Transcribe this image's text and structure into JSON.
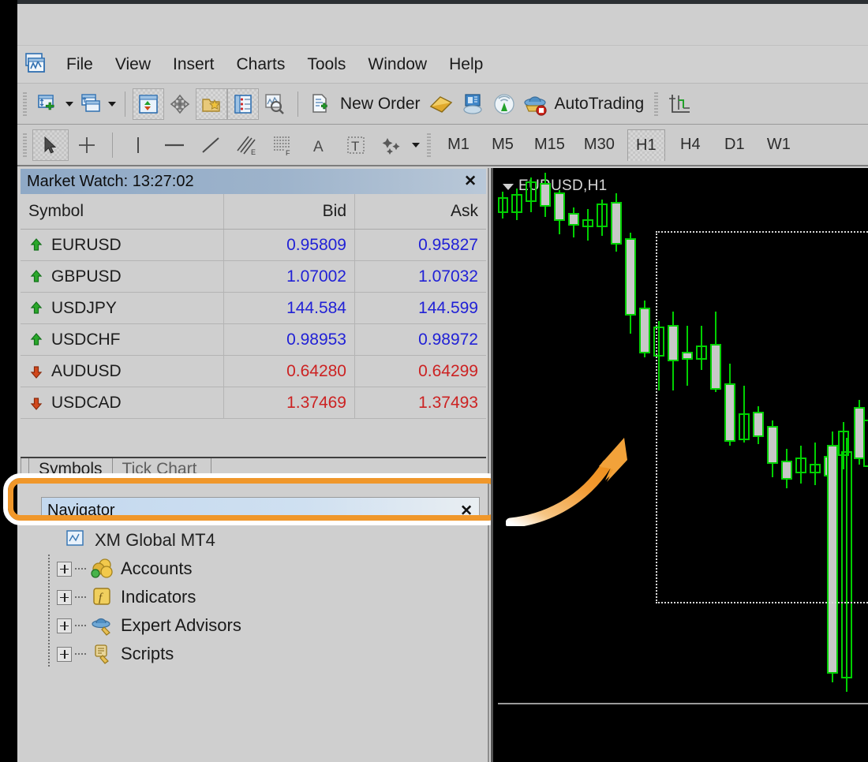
{
  "app": {
    "icon": "metatrader-app-icon"
  },
  "menu": {
    "items": [
      {
        "label": "File"
      },
      {
        "label": "View"
      },
      {
        "label": "Insert"
      },
      {
        "label": "Charts"
      },
      {
        "label": "Tools"
      },
      {
        "label": "Window"
      },
      {
        "label": "Help"
      }
    ]
  },
  "toolbar_main": {
    "buttons": [
      {
        "name": "new-chart-button",
        "icon": "new-chart-icon"
      },
      {
        "name": "new-chart-dropdown",
        "icon": "chevron-down-icon"
      },
      {
        "name": "profiles-button",
        "icon": "profiles-icon"
      },
      {
        "name": "profiles-dropdown",
        "icon": "chevron-down-icon"
      },
      {
        "name": "market-watch-button",
        "icon": "market-watch-icon"
      },
      {
        "name": "data-window-button",
        "icon": "data-window-icon"
      },
      {
        "name": "navigator-button",
        "icon": "navigator-folder-star-icon"
      },
      {
        "name": "terminal-button",
        "icon": "terminal-list-icon"
      },
      {
        "name": "strategy-tester-button",
        "icon": "strategy-tester-magnifier-icon"
      }
    ],
    "new_order_label": "New Order",
    "new_order_icon": "new-order-icon",
    "metaeditor_icon": "metaeditor-icon",
    "mql5_community_icon": "mql5-community-icon",
    "signals_icon": "signals-broadcast-icon",
    "autotrading_label": "AutoTrading",
    "autotrading_icon": "autotrading-hat-icon",
    "crosshair_icon": "crosshair-axis-icon"
  },
  "toolbar_draw": {
    "tools": [
      {
        "name": "cursor-tool",
        "icon": "cursor-arrow-icon",
        "selected": true
      },
      {
        "name": "crosshair-tool",
        "icon": "crosshair-icon",
        "selected": false
      },
      {
        "name": "vertical-line-tool",
        "icon": "vertical-line-icon",
        "selected": false
      },
      {
        "name": "horizontal-line-tool",
        "icon": "horizontal-line-icon",
        "selected": false
      },
      {
        "name": "trendline-tool",
        "icon": "trendline-icon",
        "selected": false
      },
      {
        "name": "equidistant-channel-tool",
        "icon": "equidistant-channel-icon",
        "selected": false
      },
      {
        "name": "fibonacci-retracement-tool",
        "icon": "fibonacci-icon",
        "selected": false
      },
      {
        "name": "text-tool",
        "icon": "text-a-icon",
        "selected": false
      },
      {
        "name": "text-label-tool",
        "icon": "text-label-t-icon",
        "selected": false
      },
      {
        "name": "shapes-tool",
        "icon": "shapes-icon",
        "selected": false
      },
      {
        "name": "shapes-dropdown",
        "icon": "chevron-down-icon",
        "selected": false
      }
    ],
    "timeframes": [
      {
        "label": "M1",
        "active": false
      },
      {
        "label": "M5",
        "active": false
      },
      {
        "label": "M15",
        "active": false
      },
      {
        "label": "M30",
        "active": false
      },
      {
        "label": "H1",
        "active": true
      },
      {
        "label": "H4",
        "active": false
      },
      {
        "label": "D1",
        "active": false
      },
      {
        "label": "W1",
        "active": false
      }
    ]
  },
  "market_watch": {
    "title": "Market Watch: 13:27:02",
    "close_icon": "close-x-icon",
    "columns": [
      "Symbol",
      "Bid",
      "Ask"
    ],
    "rows": [
      {
        "symbol": "EURUSD",
        "bid": "0.95809",
        "ask": "0.95827",
        "direction": "up"
      },
      {
        "symbol": "GBPUSD",
        "bid": "1.07002",
        "ask": "1.07032",
        "direction": "up"
      },
      {
        "symbol": "USDJPY",
        "bid": "144.584",
        "ask": "144.599",
        "direction": "up"
      },
      {
        "symbol": "USDCHF",
        "bid": "0.98953",
        "ask": "0.98972",
        "direction": "up"
      },
      {
        "symbol": "AUDUSD",
        "bid": "0.64280",
        "ask": "0.64299",
        "direction": "down"
      },
      {
        "symbol": "USDCAD",
        "bid": "1.37469",
        "ask": "1.37493",
        "direction": "down"
      }
    ],
    "tabs": [
      {
        "label": "Symbols",
        "active": true
      },
      {
        "label": "Tick Chart",
        "active": false
      }
    ]
  },
  "navigator": {
    "title": "Navigator",
    "close_icon": "close-x-icon",
    "highlight_color": "#f0972a",
    "root": {
      "label": "XM Global MT4",
      "icon": "mt4-terminal-icon"
    },
    "nodes": [
      {
        "label": "Accounts",
        "icon": "accounts-coins-icon",
        "expander": "plus"
      },
      {
        "label": "Indicators",
        "icon": "indicators-function-icon",
        "expander": "plus"
      },
      {
        "label": "Expert Advisors",
        "icon": "expert-advisor-hat-icon",
        "expander": "plus"
      },
      {
        "label": "Scripts",
        "icon": "scripts-scroll-icon",
        "expander": "plus"
      }
    ]
  },
  "chart": {
    "label": "EURUSD,H1",
    "dropdown_icon": "chevron-down-icon",
    "annotation_icon": "orange-curved-arrow-icon",
    "selection_rect": "chart-selection-rectangle",
    "bullish_color": "#00d000",
    "bearish_body_color": "#c8c8c8",
    "background_color": "#000000"
  },
  "chart_data": {
    "type": "candlestick",
    "title": "EURUSD,H1",
    "symbol": "EURUSD",
    "timeframe": "H1",
    "xlabel": "",
    "ylabel": "",
    "grid": false,
    "legend": "none",
    "series": [
      {
        "name": "EURUSD H1 candles",
        "fields": [
          "open",
          "high",
          "low",
          "close"
        ],
        "candles": [
          {
            "open": 0.969,
            "high": 0.9697,
            "low": 0.9684,
            "close": 0.9693
          },
          {
            "open": 0.9693,
            "high": 0.97,
            "low": 0.9686,
            "close": 0.9688
          },
          {
            "open": 0.9688,
            "high": 0.9706,
            "low": 0.9684,
            "close": 0.97
          },
          {
            "open": 0.97,
            "high": 0.9712,
            "low": 0.9692,
            "close": 0.9694
          },
          {
            "open": 0.9694,
            "high": 0.9697,
            "low": 0.9672,
            "close": 0.9676
          },
          {
            "open": 0.9676,
            "high": 0.9682,
            "low": 0.9665,
            "close": 0.9672
          },
          {
            "open": 0.9672,
            "high": 0.968,
            "low": 0.966,
            "close": 0.967
          },
          {
            "open": 0.967,
            "high": 0.9686,
            "low": 0.9664,
            "close": 0.968
          },
          {
            "open": 0.968,
            "high": 0.9692,
            "low": 0.9636,
            "close": 0.964
          },
          {
            "open": 0.964,
            "high": 0.9644,
            "low": 0.9592,
            "close": 0.9596
          },
          {
            "open": 0.9596,
            "high": 0.9608,
            "low": 0.9576,
            "close": 0.9582
          },
          {
            "open": 0.9582,
            "high": 0.9588,
            "low": 0.956,
            "close": 0.9586
          },
          {
            "open": 0.9586,
            "high": 0.96,
            "low": 0.9548,
            "close": 0.9568
          },
          {
            "open": 0.9568,
            "high": 0.958,
            "low": 0.954,
            "close": 0.9566
          },
          {
            "open": 0.9566,
            "high": 0.9586,
            "low": 0.9552,
            "close": 0.9572
          },
          {
            "open": 0.9572,
            "high": 0.9604,
            "low": 0.9532,
            "close": 0.954
          },
          {
            "open": 0.954,
            "high": 0.9548,
            "low": 0.95,
            "close": 0.9504
          },
          {
            "open": 0.9504,
            "high": 0.952,
            "low": 0.9492,
            "close": 0.9512
          },
          {
            "open": 0.9512,
            "high": 0.9528,
            "low": 0.9488,
            "close": 0.9496
          },
          {
            "open": 0.9496,
            "high": 0.95,
            "low": 0.9456,
            "close": 0.9462
          },
          {
            "open": 0.9462,
            "high": 0.9472,
            "low": 0.9444,
            "close": 0.945
          },
          {
            "open": 0.945,
            "high": 0.9462,
            "low": 0.9436,
            "close": 0.9456
          },
          {
            "open": 0.9456,
            "high": 0.9468,
            "low": 0.944,
            "close": 0.9444
          },
          {
            "open": 0.9444,
            "high": 0.9476,
            "low": 0.9438,
            "close": 0.947
          },
          {
            "open": 0.947,
            "high": 0.9482,
            "low": 0.9452,
            "close": 0.9458
          },
          {
            "open": 0.9458,
            "high": 0.9466,
            "low": 0.934,
            "close": 0.9352
          },
          {
            "open": 0.9352,
            "high": 0.946,
            "low": 0.9332,
            "close": 0.944
          },
          {
            "open": 0.944,
            "high": 0.9472,
            "low": 0.9448,
            "close": 0.946
          },
          {
            "open": 0.946,
            "high": 0.949,
            "low": 0.945,
            "close": 0.9482
          }
        ]
      }
    ]
  }
}
